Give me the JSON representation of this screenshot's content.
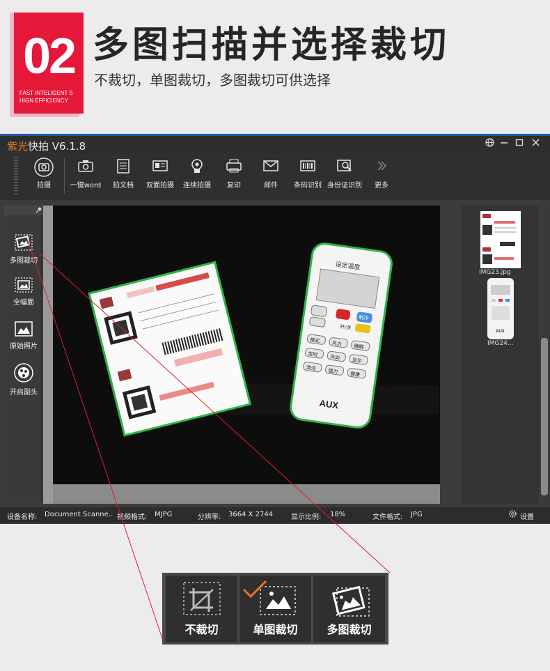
{
  "banner": {
    "number": "02",
    "tagline_line1": "FAST INTELIGENT S",
    "tagline_line2": "HIGN EFFICIENCY",
    "headline": "多图扫描并选择裁切",
    "subline": "不裁切，单图裁切，多图裁切可供选择"
  },
  "window": {
    "brand": "紫光",
    "app_name": "快拍 V6.1.8",
    "controls": [
      "globe-icon",
      "minimize-icon",
      "maximize-icon",
      "close-icon"
    ]
  },
  "toolbar": {
    "items": [
      {
        "label": "拍摄",
        "icon": "camera-icon"
      },
      {
        "label": "一键word",
        "icon": "camera-icon"
      },
      {
        "label": "拍文档",
        "icon": "document-icon"
      },
      {
        "label": "双面拍摄",
        "icon": "id-card-icon"
      },
      {
        "label": "连续拍摄",
        "icon": "timer-camera-icon"
      },
      {
        "label": "复印",
        "icon": "copy-icon"
      },
      {
        "label": "邮件",
        "icon": "mail-icon"
      },
      {
        "label": "条码识别",
        "icon": "barcode-icon"
      },
      {
        "label": "身份证识别",
        "icon": "id-scan-icon"
      },
      {
        "label": "更多",
        "icon": "more-icon"
      }
    ]
  },
  "sidebar": {
    "items": [
      {
        "label": "多图裁切",
        "icon": "multi-crop-icon"
      },
      {
        "label": "全幅面",
        "icon": "full-frame-icon"
      },
      {
        "label": "原始照片",
        "icon": "photo-icon"
      },
      {
        "label": "开启副头",
        "icon": "secondary-camera-icon"
      }
    ]
  },
  "thumbnails": [
    {
      "name": "IMG23.jpg"
    },
    {
      "name": "IMG24..."
    }
  ],
  "remote": {
    "display_text": "设定温度",
    "power": "开/关",
    "cool": "制冷",
    "mode": "模式",
    "wind": "风力",
    "sleep": "睡眠",
    "timer": "定时",
    "swing": "风向",
    "display": "显示",
    "clean": "清洁",
    "strong": "强力",
    "health": "健康",
    "brand": "AUX"
  },
  "status": {
    "device_label": "设备名称:",
    "device_value": "Document Scanne..",
    "format_label": "视频格式:",
    "format_value": "MJPG",
    "res_label": "分辨率:",
    "res_value": "3664 X 2744",
    "scale_label": "显示比例:",
    "scale_value": "18%",
    "file_label": "文件格式:",
    "file_value": "JPG",
    "settings_label": "设置"
  },
  "zoom": {
    "no_crop": "不裁切",
    "single_crop": "单图裁切",
    "multi_crop": "多图裁切"
  },
  "colors": {
    "accent_red": "#e6183a",
    "crop_green": "#2db34a",
    "guide_line": "#d9232c",
    "check_orange": "#e8752a"
  }
}
